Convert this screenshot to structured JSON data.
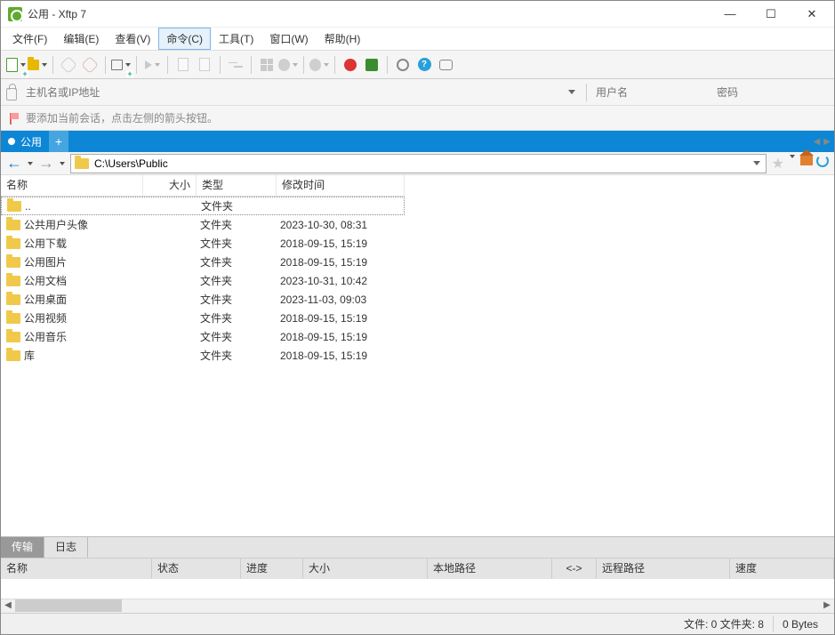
{
  "titlebar": {
    "title": "公用 - Xftp 7"
  },
  "menu": {
    "file": "文件(F)",
    "edit": "编辑(E)",
    "view": "查看(V)",
    "command": "命令(C)",
    "tool": "工具(T)",
    "window": "窗口(W)",
    "help": "帮助(H)"
  },
  "address": {
    "host_placeholder": "主机名或IP地址",
    "user_placeholder": "用户名",
    "pass_placeholder": "密码"
  },
  "hint": "要添加当前会话，点击左侧的箭头按钮。",
  "session_tab": {
    "label": "公用",
    "add": "+"
  },
  "path": {
    "value": "C:\\Users\\Public"
  },
  "columns": {
    "name": "名称",
    "size": "大小",
    "type": "类型",
    "modified": "修改时间"
  },
  "files": [
    {
      "name": "..",
      "type": "文件夹",
      "modified": ""
    },
    {
      "name": "公共用户头像",
      "type": "文件夹",
      "modified": "2023-10-30, 08:31"
    },
    {
      "name": "公用下载",
      "type": "文件夹",
      "modified": "2018-09-15, 15:19"
    },
    {
      "name": "公用图片",
      "type": "文件夹",
      "modified": "2018-09-15, 15:19"
    },
    {
      "name": "公用文档",
      "type": "文件夹",
      "modified": "2023-10-31, 10:42"
    },
    {
      "name": "公用桌面",
      "type": "文件夹",
      "modified": "2023-11-03, 09:03"
    },
    {
      "name": "公用视频",
      "type": "文件夹",
      "modified": "2018-09-15, 15:19"
    },
    {
      "name": "公用音乐",
      "type": "文件夹",
      "modified": "2018-09-15, 15:19"
    },
    {
      "name": "库",
      "type": "文件夹",
      "modified": "2018-09-15, 15:19"
    }
  ],
  "bottom_tabs": {
    "transfer": "传输",
    "log": "日志"
  },
  "transfer_cols": {
    "name": "名称",
    "status": "状态",
    "progress": "进度",
    "size": "大小",
    "local": "本地路径",
    "dir": "<->",
    "remote": "远程路径",
    "speed": "速度"
  },
  "status": {
    "files": "文件: 0 文件夹: 8",
    "bytes": "0 Bytes"
  }
}
